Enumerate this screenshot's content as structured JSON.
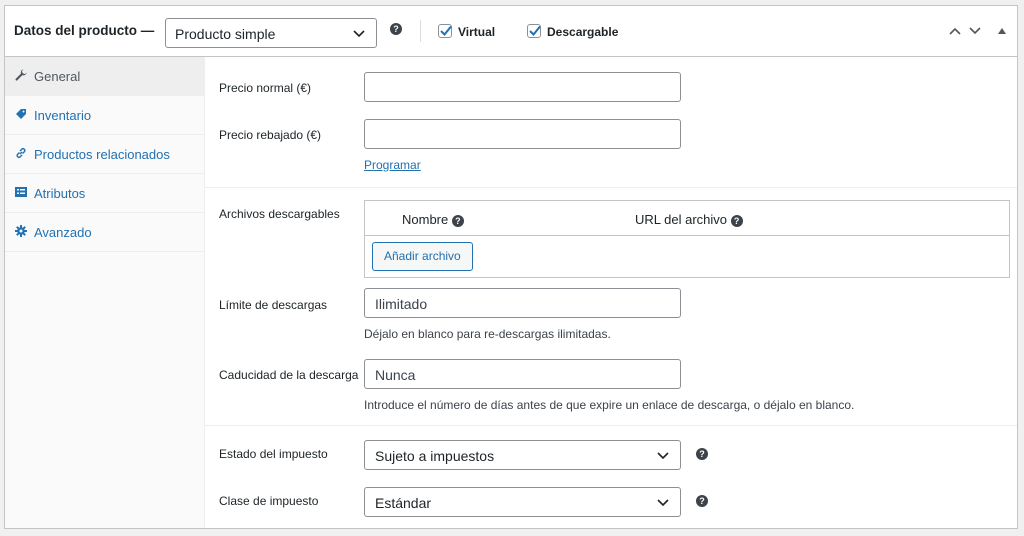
{
  "header": {
    "title": "Datos del producto —",
    "product_type": "Producto simple",
    "virtual_label": "Virtual",
    "downloadable_label": "Descargable",
    "virtual_checked": true,
    "downloadable_checked": true
  },
  "tabs": [
    {
      "label": "General",
      "icon": "wrench-icon",
      "active": true
    },
    {
      "label": "Inventario",
      "icon": "tag-icon",
      "active": false
    },
    {
      "label": "Productos relacionados",
      "icon": "link-icon",
      "active": false
    },
    {
      "label": "Atributos",
      "icon": "list-icon",
      "active": false
    },
    {
      "label": "Avanzado",
      "icon": "gear-icon",
      "active": false
    }
  ],
  "general": {
    "regular_price_label": "Precio normal (€)",
    "regular_price_value": "",
    "sale_price_label": "Precio rebajado (€)",
    "sale_price_value": "",
    "schedule_link": "Programar",
    "downloadable_files_label": "Archivos descargables",
    "files_table": {
      "col_name": "Nombre",
      "col_url": "URL del archivo",
      "add_button": "Añadir archivo"
    },
    "download_limit_label": "Límite de descargas",
    "download_limit_placeholder": "Ilimitado",
    "download_limit_desc": "Déjalo en blanco para re-descargas ilimitadas.",
    "download_expiry_label": "Caducidad de la descarga",
    "download_expiry_placeholder": "Nunca",
    "download_expiry_desc": "Introduce el número de días antes de que expire un enlace de descarga, o déjalo en blanco.",
    "tax_status_label": "Estado del impuesto",
    "tax_status_value": "Sujeto a impuestos",
    "tax_class_label": "Clase de impuesto",
    "tax_class_value": "Estándar"
  },
  "colors": {
    "accent": "#2271b1",
    "border": "#c3c4c7"
  }
}
